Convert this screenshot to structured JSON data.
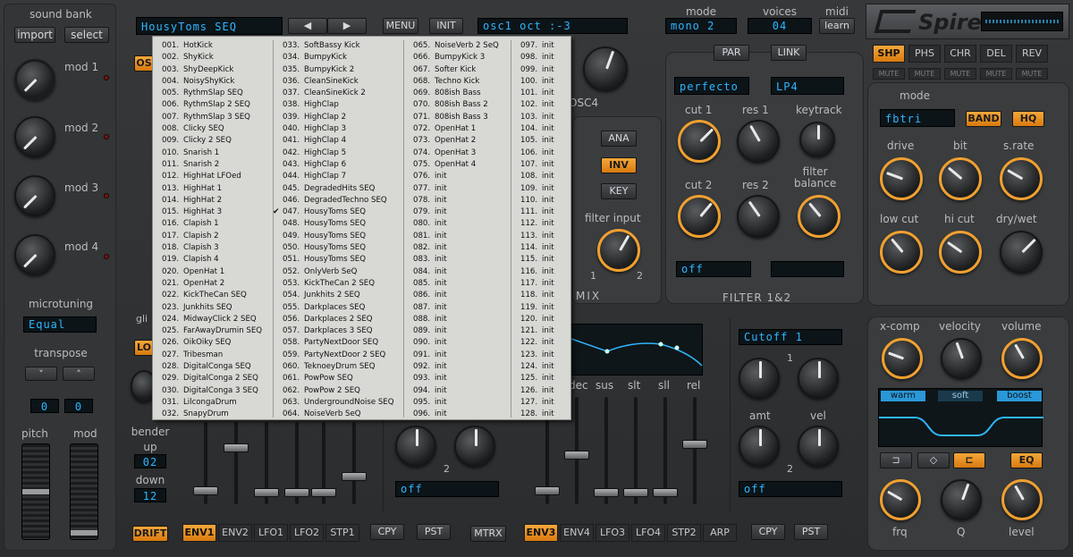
{
  "sound_bank": {
    "title": "sound bank",
    "import": "import",
    "select": "select"
  },
  "mods": [
    "mod 1",
    "mod 2",
    "mod 3",
    "mod 4"
  ],
  "microtuning": {
    "title": "microtuning",
    "value": "Equal"
  },
  "transpose": {
    "title": "transpose",
    "up": "˄",
    "down": "˅",
    "v1": "0",
    "v2": "0"
  },
  "wheels": {
    "pitch": "pitch",
    "mod": "mod"
  },
  "bender": {
    "title": "bender",
    "up_label": "up",
    "up_value": "02",
    "down_label": "down",
    "down_value": "12"
  },
  "drift": "DRIFT",
  "header": {
    "patch_name": "HousyToms SEQ",
    "prev": "◀",
    "next": "▶",
    "menu": "MENU",
    "init": "INIT",
    "osc_display": "osc1 oct  :-3"
  },
  "mode": {
    "title": "mode",
    "value": "mono 2"
  },
  "voices": {
    "title": "voices",
    "value": "04"
  },
  "midi": {
    "title": "midi",
    "button": "learn"
  },
  "logo": "Spire",
  "fx_tabs": [
    "SHP",
    "PHS",
    "CHR",
    "DEL",
    "REV"
  ],
  "mute_label": "MUTE",
  "filter": {
    "par": "PAR",
    "link": "LINK",
    "type1": "perfecto",
    "type2": "LP4",
    "cut1": "cut 1",
    "res1": "res 1",
    "keytrack": "keytrack",
    "cut2": "cut 2",
    "res2": "res 2",
    "balance": "filter\nbalance",
    "ana": "ANA",
    "inv": "INV",
    "key": "KEY",
    "filter_input": "filter input",
    "in1": "1",
    "in2": "2",
    "off": "off",
    "title": "FILTER 1&2",
    "osc4": "OSC4",
    "mix": "MIX"
  },
  "shaper": {
    "mode_title": "mode",
    "mode_value": "fbtri",
    "band": "BAND",
    "hq": "HQ",
    "drive": "drive",
    "bit": "bit",
    "srate": "s.rate",
    "lowcut": "low cut",
    "hicut": "hi cut",
    "drywet": "dry/wet"
  },
  "eq": {
    "xcomp": "x-comp",
    "velocity": "velocity",
    "volume": "volume",
    "warm": "warm",
    "soft": "soft",
    "boost": "boost",
    "eq": "EQ",
    "frq": "frq",
    "q": "Q",
    "level": "level"
  },
  "env": {
    "labels": [
      "dec",
      "sus",
      "slt",
      "sll",
      "rel"
    ],
    "dest": "Cutoff 1",
    "amt": "amt",
    "vel": "vel",
    "one": "1",
    "two": "2",
    "off": "off"
  },
  "left_bottom": {
    "off": "off",
    "two": "2"
  },
  "bottom_tabs_left": [
    "ENV1",
    "ENV2",
    "LFO1",
    "LFO2",
    "STP1"
  ],
  "bottom_tabs_right": [
    "ENV3",
    "ENV4",
    "LFO3",
    "LFO4",
    "STP2",
    "ARP"
  ],
  "copy": "CPY",
  "paste": "PST",
  "mtrx": "MTRX",
  "partial_labels": {
    "os": "OS",
    "gli": "gli",
    "lo": "LO"
  },
  "presets": [
    [
      "001.",
      "HotKick"
    ],
    [
      "002.",
      "ShyKick"
    ],
    [
      "003.",
      "ShyDeepKick"
    ],
    [
      "004.",
      "NoisyShyKick"
    ],
    [
      "005.",
      "RythmSlap SEQ"
    ],
    [
      "006.",
      "RythmSlap 2 SEQ"
    ],
    [
      "007.",
      "RythmSlap 3 SEQ"
    ],
    [
      "008.",
      "Clicky SEQ"
    ],
    [
      "009.",
      "Clicky 2 SEQ"
    ],
    [
      "010.",
      "Snarish 1"
    ],
    [
      "011.",
      "Snarish 2"
    ],
    [
      "012.",
      "HighHat LFOed"
    ],
    [
      "013.",
      "HighHat 1"
    ],
    [
      "014.",
      "HighHat 2"
    ],
    [
      "015.",
      "HighHat 3"
    ],
    [
      "016.",
      "Clapish 1"
    ],
    [
      "017.",
      "Clapish 2"
    ],
    [
      "018.",
      "Clapish 3"
    ],
    [
      "019.",
      "Clapish 4"
    ],
    [
      "020.",
      "OpenHat 1"
    ],
    [
      "021.",
      "OpenHat 2"
    ],
    [
      "022.",
      "KickTheCan SEQ"
    ],
    [
      "023.",
      "Junkhits SEQ"
    ],
    [
      "024.",
      "MidwayClick 2 SEQ"
    ],
    [
      "025.",
      "FarAwayDrumin SEQ"
    ],
    [
      "026.",
      "OikOiky SEQ"
    ],
    [
      "027.",
      "Tribesman"
    ],
    [
      "028.",
      "DigitalConga SEQ"
    ],
    [
      "029.",
      "DigitalConga 2 SEQ"
    ],
    [
      "030.",
      "DigitalConga 3 SEQ"
    ],
    [
      "031.",
      "LilcongaDrum"
    ],
    [
      "032.",
      "SnapyDrum"
    ],
    [
      "033.",
      "SoftBassy Kick"
    ],
    [
      "034.",
      "BumpyKick"
    ],
    [
      "035.",
      "BumpyKick 2"
    ],
    [
      "036.",
      "CleanSineKick"
    ],
    [
      "037.",
      "CleanSineKick 2"
    ],
    [
      "038.",
      "HighClap"
    ],
    [
      "039.",
      "HighClap 2"
    ],
    [
      "040.",
      "HighClap 3"
    ],
    [
      "041.",
      "HighClap 4"
    ],
    [
      "042.",
      "HighClap 5"
    ],
    [
      "043.",
      "HighClap 6"
    ],
    [
      "044.",
      "HighClap 7"
    ],
    [
      "045.",
      "DegradedHits SEQ"
    ],
    [
      "046.",
      "DegradedTechno SEQ"
    ],
    [
      "047.",
      "HousyToms SEQ"
    ],
    [
      "048.",
      "HousyToms SEQ"
    ],
    [
      "049.",
      "HousyToms SEQ"
    ],
    [
      "050.",
      "HousyToms SEQ"
    ],
    [
      "051.",
      "HousyToms SEQ"
    ],
    [
      "052.",
      "OnlyVerb SeQ"
    ],
    [
      "053.",
      "KickTheCan 2 SEQ"
    ],
    [
      "054.",
      "Junkhits 2 SEQ"
    ],
    [
      "055.",
      "Darkplaces SEQ"
    ],
    [
      "056.",
      "Darkplaces 2 SEQ"
    ],
    [
      "057.",
      "Darkplaces 3 SEQ"
    ],
    [
      "058.",
      "PartyNextDoor SEQ"
    ],
    [
      "059.",
      "PartyNextDoor 2 SEQ"
    ],
    [
      "060.",
      "TeknoeyDrum SEQ"
    ],
    [
      "061.",
      "PowPow SEQ"
    ],
    [
      "062.",
      "PowPow 2 SEQ"
    ],
    [
      "063.",
      "UndergroundNoise SEQ"
    ],
    [
      "064.",
      "NoiseVerb SeQ"
    ],
    [
      "065.",
      "NoiseVerb 2 SeQ"
    ],
    [
      "066.",
      "BumpyKick 3"
    ],
    [
      "067.",
      "Softer Kick"
    ],
    [
      "068.",
      "Techno Kick"
    ],
    [
      "069.",
      "808ish Bass"
    ],
    [
      "070.",
      "808ish Bass 2"
    ],
    [
      "071.",
      "808ish Bass 3"
    ],
    [
      "072.",
      "OpenHat 1"
    ],
    [
      "073.",
      "OpenHat 2"
    ],
    [
      "074.",
      "OpenHat 3"
    ],
    [
      "075.",
      "OpenHat 4"
    ],
    [
      "076.",
      "init"
    ],
    [
      "077.",
      "init"
    ],
    [
      "078.",
      "init"
    ],
    [
      "079.",
      "init"
    ],
    [
      "080.",
      "init"
    ],
    [
      "081.",
      "init"
    ],
    [
      "082.",
      "init"
    ],
    [
      "083.",
      "init"
    ],
    [
      "084.",
      "init"
    ],
    [
      "085.",
      "init"
    ],
    [
      "086.",
      "init"
    ],
    [
      "087.",
      "init"
    ],
    [
      "088.",
      "init"
    ],
    [
      "089.",
      "init"
    ],
    [
      "090.",
      "init"
    ],
    [
      "091.",
      "init"
    ],
    [
      "092.",
      "init"
    ],
    [
      "093.",
      "init"
    ],
    [
      "094.",
      "init"
    ],
    [
      "095.",
      "init"
    ],
    [
      "096.",
      "init"
    ],
    [
      "097.",
      "init"
    ],
    [
      "098.",
      "init"
    ],
    [
      "099.",
      "init"
    ],
    [
      "100.",
      "init"
    ],
    [
      "101.",
      "init"
    ],
    [
      "102.",
      "init"
    ],
    [
      "103.",
      "init"
    ],
    [
      "104.",
      "init"
    ],
    [
      "105.",
      "init"
    ],
    [
      "106.",
      "init"
    ],
    [
      "107.",
      "init"
    ],
    [
      "108.",
      "init"
    ],
    [
      "109.",
      "init"
    ],
    [
      "110.",
      "init"
    ],
    [
      "111.",
      "init"
    ],
    [
      "112.",
      "init"
    ],
    [
      "113.",
      "init"
    ],
    [
      "114.",
      "init"
    ],
    [
      "115.",
      "init"
    ],
    [
      "116.",
      "init"
    ],
    [
      "117.",
      "init"
    ],
    [
      "118.",
      "init"
    ],
    [
      "119.",
      "init"
    ],
    [
      "120.",
      "init"
    ],
    [
      "121.",
      "init"
    ],
    [
      "122.",
      "init"
    ],
    [
      "123.",
      "init"
    ],
    [
      "124.",
      "init"
    ],
    [
      "125.",
      "init"
    ],
    [
      "126.",
      "init"
    ],
    [
      "127.",
      "init"
    ],
    [
      "128.",
      "init"
    ]
  ],
  "selected_preset": "047.",
  "check": "✔",
  "colors": {
    "accent": "#f0a030",
    "lcd_text": "#2fb6ff",
    "lcd_bg": "#0c1418",
    "menu_bg": "#d8d8d4"
  }
}
